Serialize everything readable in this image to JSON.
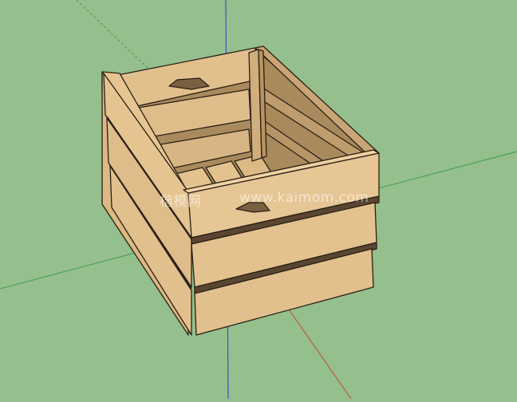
{
  "scene": {
    "subject": "crate-3d-model",
    "background_color": "#95bf8c",
    "wood_color": "#e2c08e",
    "wood_shade_color": "#c9a576",
    "outline_color": "#2a2016",
    "axis_colors": {
      "red": "#c24a3c",
      "green": "#3f9a5a",
      "blue": "#3a3ad0"
    }
  },
  "watermark": {
    "cn": "楷模网",
    "url": "www.kaimom.com"
  }
}
